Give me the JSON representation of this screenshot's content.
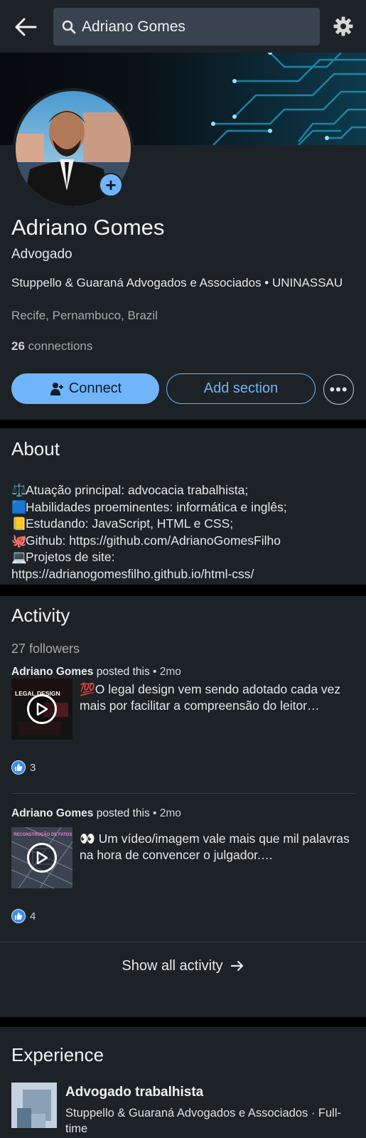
{
  "topbar": {
    "search_value": "Adriano Gomes",
    "back_icon": "arrow-left-icon",
    "settings_icon": "gear-icon"
  },
  "profile": {
    "name": "Adriano Gomes",
    "headline": "Advogado",
    "company_line": "Stuppello & Guaraná Advogados e Associados • UNINASSAU",
    "location": "Recife, Pernambuco, Brazil",
    "connections_count": "26",
    "connections_label": "connections",
    "connect_label": "Connect",
    "add_section_label": "Add section",
    "more_label": "•••"
  },
  "about": {
    "title": "About",
    "lines": [
      {
        "emoji": "⚖️",
        "text": "Atuação principal: advocacia trabalhista;"
      },
      {
        "emoji": "🟦",
        "text": "Habilidades proeminentes: informática e inglês;"
      },
      {
        "emoji": "📒",
        "text": "Estudando: JavaScript, HTML e CSS;"
      },
      {
        "emoji": "🐙",
        "text": "Github: https://github.com/AdrianoGomesFilho"
      },
      {
        "emoji": "💻",
        "text": "Projetos de site:"
      },
      {
        "emoji": "",
        "text": "https://adrianogomesfilho.github.io/html-css/"
      }
    ]
  },
  "activity": {
    "title": "Activity",
    "followers": "27 followers",
    "posts": [
      {
        "author": "Adriano Gomes",
        "action": "posted this",
        "time": "2mo",
        "text": "💯O legal design vem sendo adotado cada vez mais por facilitar a compreensão do leitor…",
        "thumb_label": "LEGAL DESIGN",
        "reactions": "3"
      },
      {
        "author": "Adriano Gomes",
        "action": "posted this",
        "time": "2mo",
        "text": "👀 Um vídeo/imagem vale mais que mil palavras na hora de convencer o julgador.…",
        "thumb_label": "RECONSTRUÇÃO DE FATOS",
        "reactions": "4"
      }
    ],
    "show_all_label": "Show all activity"
  },
  "experience": {
    "title": "Experience",
    "items": [
      {
        "title": "Advogado trabalhista",
        "company": "Stuppello & Guaraná Advogados e Associados · Full-time"
      }
    ]
  },
  "colors": {
    "card_bg": "#1d2226",
    "page_bg": "#000000",
    "accent": "#70b5f9",
    "search_bg": "#38434f"
  }
}
